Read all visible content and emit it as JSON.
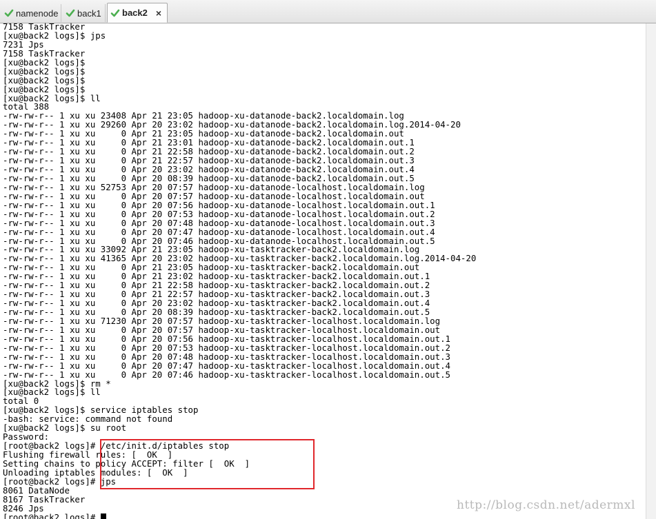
{
  "tabs": [
    {
      "label": "namenode",
      "active": false,
      "icon": "check-icon"
    },
    {
      "label": "back1",
      "active": false,
      "icon": "check-icon"
    },
    {
      "label": "back2",
      "active": true,
      "icon": "check-icon",
      "close": "×"
    }
  ],
  "colors": {
    "tab_check": "#4caf50",
    "highlight_box": "#e0262b",
    "watermark": "#b9b9b9"
  },
  "terminal_lines": [
    "7158 TaskTracker",
    "[xu@back2 logs]$ jps",
    "7231 Jps",
    "7158 TaskTracker",
    "[xu@back2 logs]$",
    "[xu@back2 logs]$",
    "[xu@back2 logs]$",
    "[xu@back2 logs]$",
    "[xu@back2 logs]$ ll",
    "total 388",
    "-rw-rw-r-- 1 xu xu 23408 Apr 21 23:05 hadoop-xu-datanode-back2.localdomain.log",
    "-rw-rw-r-- 1 xu xu 29260 Apr 20 23:02 hadoop-xu-datanode-back2.localdomain.log.2014-04-20",
    "-rw-rw-r-- 1 xu xu     0 Apr 21 23:05 hadoop-xu-datanode-back2.localdomain.out",
    "-rw-rw-r-- 1 xu xu     0 Apr 21 23:01 hadoop-xu-datanode-back2.localdomain.out.1",
    "-rw-rw-r-- 1 xu xu     0 Apr 21 22:58 hadoop-xu-datanode-back2.localdomain.out.2",
    "-rw-rw-r-- 1 xu xu     0 Apr 21 22:57 hadoop-xu-datanode-back2.localdomain.out.3",
    "-rw-rw-r-- 1 xu xu     0 Apr 20 23:02 hadoop-xu-datanode-back2.localdomain.out.4",
    "-rw-rw-r-- 1 xu xu     0 Apr 20 08:39 hadoop-xu-datanode-back2.localdomain.out.5",
    "-rw-rw-r-- 1 xu xu 52753 Apr 20 07:57 hadoop-xu-datanode-localhost.localdomain.log",
    "-rw-rw-r-- 1 xu xu     0 Apr 20 07:57 hadoop-xu-datanode-localhost.localdomain.out",
    "-rw-rw-r-- 1 xu xu     0 Apr 20 07:56 hadoop-xu-datanode-localhost.localdomain.out.1",
    "-rw-rw-r-- 1 xu xu     0 Apr 20 07:53 hadoop-xu-datanode-localhost.localdomain.out.2",
    "-rw-rw-r-- 1 xu xu     0 Apr 20 07:48 hadoop-xu-datanode-localhost.localdomain.out.3",
    "-rw-rw-r-- 1 xu xu     0 Apr 20 07:47 hadoop-xu-datanode-localhost.localdomain.out.4",
    "-rw-rw-r-- 1 xu xu     0 Apr 20 07:46 hadoop-xu-datanode-localhost.localdomain.out.5",
    "-rw-rw-r-- 1 xu xu 33092 Apr 21 23:05 hadoop-xu-tasktracker-back2.localdomain.log",
    "-rw-rw-r-- 1 xu xu 41365 Apr 20 23:02 hadoop-xu-tasktracker-back2.localdomain.log.2014-04-20",
    "-rw-rw-r-- 1 xu xu     0 Apr 21 23:05 hadoop-xu-tasktracker-back2.localdomain.out",
    "-rw-rw-r-- 1 xu xu     0 Apr 21 23:02 hadoop-xu-tasktracker-back2.localdomain.out.1",
    "-rw-rw-r-- 1 xu xu     0 Apr 21 22:58 hadoop-xu-tasktracker-back2.localdomain.out.2",
    "-rw-rw-r-- 1 xu xu     0 Apr 21 22:57 hadoop-xu-tasktracker-back2.localdomain.out.3",
    "-rw-rw-r-- 1 xu xu     0 Apr 20 23:02 hadoop-xu-tasktracker-back2.localdomain.out.4",
    "-rw-rw-r-- 1 xu xu     0 Apr 20 08:39 hadoop-xu-tasktracker-back2.localdomain.out.5",
    "-rw-rw-r-- 1 xu xu 71230 Apr 20 07:57 hadoop-xu-tasktracker-localhost.localdomain.log",
    "-rw-rw-r-- 1 xu xu     0 Apr 20 07:57 hadoop-xu-tasktracker-localhost.localdomain.out",
    "-rw-rw-r-- 1 xu xu     0 Apr 20 07:56 hadoop-xu-tasktracker-localhost.localdomain.out.1",
    "-rw-rw-r-- 1 xu xu     0 Apr 20 07:53 hadoop-xu-tasktracker-localhost.localdomain.out.2",
    "-rw-rw-r-- 1 xu xu     0 Apr 20 07:48 hadoop-xu-tasktracker-localhost.localdomain.out.3",
    "-rw-rw-r-- 1 xu xu     0 Apr 20 07:47 hadoop-xu-tasktracker-localhost.localdomain.out.4",
    "-rw-rw-r-- 1 xu xu     0 Apr 20 07:46 hadoop-xu-tasktracker-localhost.localdomain.out.5",
    "[xu@back2 logs]$ rm *",
    "[xu@back2 logs]$ ll",
    "total 0",
    "[xu@back2 logs]$ service iptables stop",
    "-bash: service: command not found",
    "[xu@back2 logs]$ su root",
    "Password:",
    "[root@back2 logs]# /etc/init.d/iptables stop",
    "Flushing firewall rules: [  OK  ]",
    "Setting chains to policy ACCEPT: filter [  OK  ]",
    "Unloading iptables modules: [  OK  ]",
    "[root@back2 logs]# jps",
    "8061 DataNode",
    "8167 TaskTracker",
    "8246 Jps",
    "[root@back2 logs]# "
  ],
  "watermark": "http://blog.csdn.net/adermxl"
}
